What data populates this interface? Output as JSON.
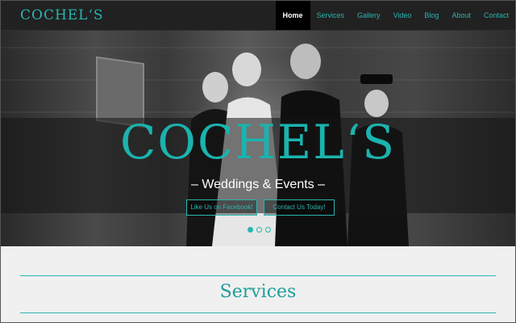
{
  "brand": {
    "logo_text": "COCHELʻS",
    "accent_color": "#2ab5b0"
  },
  "nav": {
    "items": [
      {
        "label": "Home",
        "active": true
      },
      {
        "label": "Services",
        "active": false
      },
      {
        "label": "Gallery",
        "active": false
      },
      {
        "label": "Video",
        "active": false
      },
      {
        "label": "Blog",
        "active": false
      },
      {
        "label": "About",
        "active": false
      },
      {
        "label": "Contact",
        "active": false
      }
    ]
  },
  "hero": {
    "title": "COCHELʻS",
    "subtitle": "– Weddings & Events –",
    "buttons": {
      "facebook": "Like Us on Facebook!",
      "contact": "Contact Us Today!"
    },
    "slider": {
      "dot_count": 3,
      "active_index": 0
    }
  },
  "services": {
    "title": "Services"
  },
  "icons": {
    "diamond": "diamond-icon"
  }
}
